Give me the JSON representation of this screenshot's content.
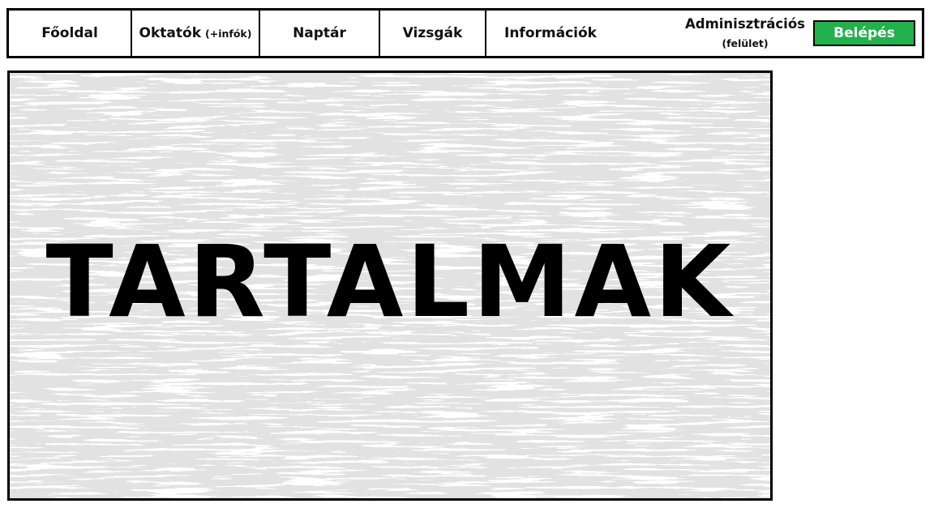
{
  "nav": {
    "home": "Főoldal",
    "instructors": "Oktatók",
    "instructors_sub": "(+infók)",
    "calendar": "Naptár",
    "exams": "Vizsgák",
    "info": "Információk",
    "admin_title": "Adminisztrációs",
    "admin_sub": "(felület)",
    "login": "Belépés"
  },
  "content": {
    "title": "TARTALMAK"
  },
  "colors": {
    "login_button": "#22b14c",
    "texture": "#c3c3c3"
  }
}
